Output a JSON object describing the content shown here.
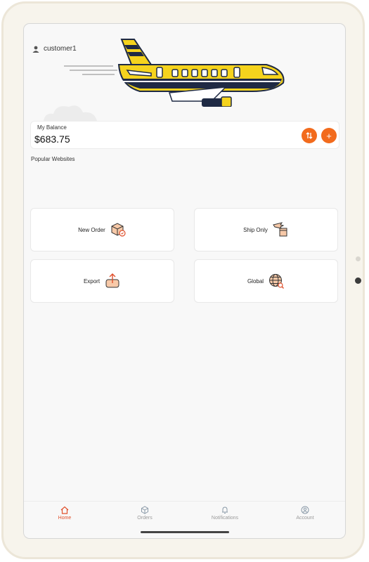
{
  "header": {
    "username": "customer1"
  },
  "balance": {
    "label": "My Balance",
    "value": "$683.75",
    "transfer_icon": "swap-vertical-icon",
    "add_label": "+"
  },
  "section": {
    "title": "Popular Websites"
  },
  "tiles": [
    {
      "label": "New Order",
      "icon": "package-icon"
    },
    {
      "label": "Ship Only",
      "icon": "plane-box-icon"
    },
    {
      "label": "Export",
      "icon": "export-icon"
    },
    {
      "label": "Global",
      "icon": "globe-search-icon"
    }
  ],
  "tabs": [
    {
      "label": "Home",
      "icon": "home-icon",
      "active": true
    },
    {
      "label": "Orders",
      "icon": "cube-icon",
      "active": false
    },
    {
      "label": "Notifications",
      "icon": "bell-icon",
      "active": false
    },
    {
      "label": "Account",
      "icon": "user-circle-icon",
      "active": false
    }
  ],
  "colors": {
    "accent": "#f26b1d",
    "active_tab": "#e0502c",
    "plane_yellow": "#f5d31d",
    "plane_navy": "#1f2a44"
  }
}
